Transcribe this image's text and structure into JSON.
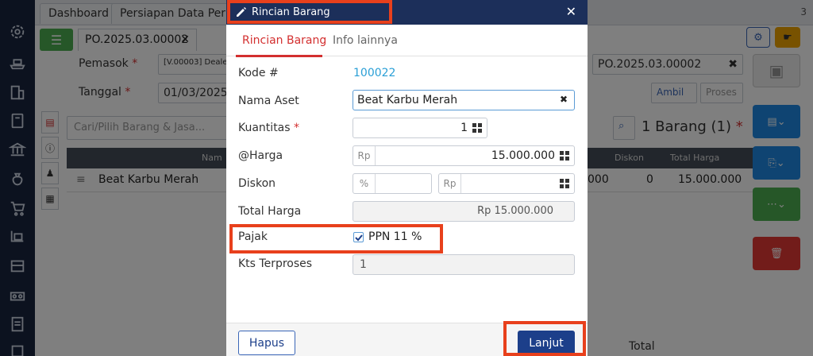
{
  "app": {
    "tabs": [
      "Dashboard",
      "Persiapan Data Perus"
    ],
    "tab_count": "3",
    "doc_tab": "PO.2025.03.00002",
    "supplier_label": "Pemasok",
    "supplier_value": "[V.00003] Deale",
    "date_label": "Tanggal",
    "date_value": "01/03/2025",
    "po_number": "PO.2025.03.00002",
    "search_placeholder": "Cari/Pilih Barang & Jasa...",
    "ambil_label": "Ambil",
    "proses_label": "Proses",
    "summary": "1 Barang (1)",
    "table": {
      "col_name": "Nam",
      "col_diskon": "Diskon",
      "col_total": "Total Harga",
      "row": {
        "name": "Beat Karbu Merah",
        "price_partial": "000",
        "diskon": "0",
        "total": "15.000.000"
      }
    },
    "footer_total": "Total"
  },
  "modal": {
    "title": "Rincian Barang",
    "tabs": [
      "Rincian Barang",
      "Info lainnya"
    ],
    "fields": {
      "kode_label": "Kode #",
      "kode_value": "100022",
      "nama_label": "Nama Aset",
      "nama_value": "Beat Karbu Merah",
      "kuantitas_label": "Kuantitas",
      "kuantitas_value": "1",
      "harga_label": "@Harga",
      "harga_prefix": "Rp",
      "harga_value": "15.000.000",
      "diskon_label": "Diskon",
      "diskon_pct_prefix": "%",
      "diskon_rp_prefix": "Rp",
      "total_label": "Total Harga",
      "total_value": "Rp 15.000.000",
      "pajak_label": "Pajak",
      "pajak_option": "PPN 11 %",
      "kts_label": "Kts Terproses",
      "kts_value": "1"
    },
    "buttons": {
      "hapus": "Hapus",
      "lanjut": "Lanjut"
    }
  },
  "colors": {
    "accent": "#d32f2f",
    "primary": "#1c3f8a",
    "highlight": "#e8401c"
  }
}
